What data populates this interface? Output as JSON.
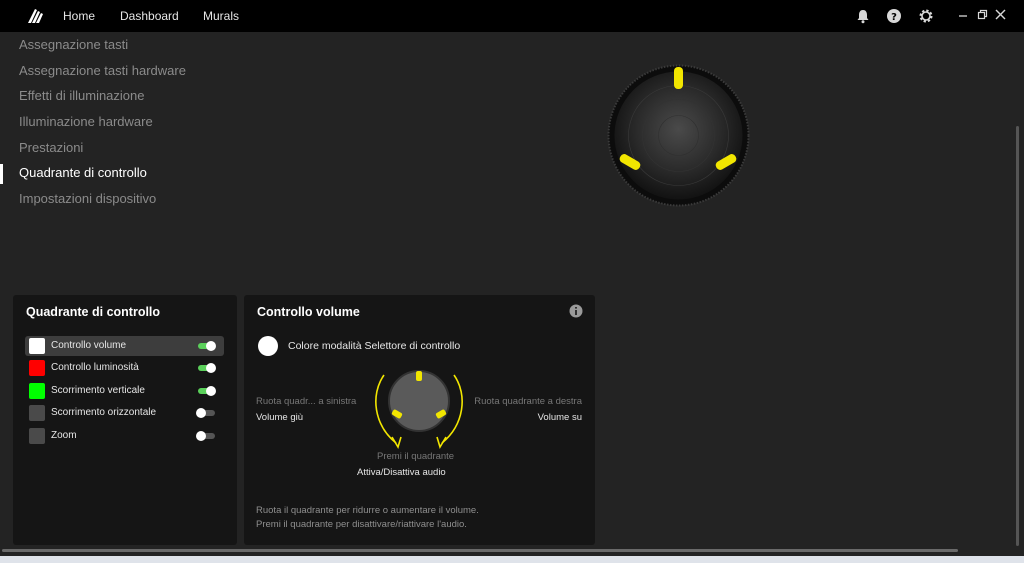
{
  "topbar": {
    "nav": [
      "Home",
      "Dashboard",
      "Murals"
    ],
    "icons": [
      "bell-icon",
      "help-icon",
      "gear-icon"
    ],
    "window_controls": [
      "minimize-icon",
      "restore-icon",
      "close-icon"
    ]
  },
  "sidebar": {
    "items": [
      {
        "label": "Assegnazione tasti"
      },
      {
        "label": "Assegnazione tasti hardware"
      },
      {
        "label": "Effetti di illuminazione"
      },
      {
        "label": "Illuminazione hardware"
      },
      {
        "label": "Prestazioni"
      },
      {
        "label": "Quadrante di controllo",
        "active": true
      },
      {
        "label": "Impostazioni dispositivo"
      }
    ]
  },
  "dial_panel": {
    "title": "Quadrante di controllo",
    "items": [
      {
        "label": "Controllo volume",
        "color": "#ffffff",
        "enabled": true,
        "selected": true
      },
      {
        "label": "Controllo luminosità",
        "color": "#ff0000",
        "enabled": true
      },
      {
        "label": "Scorrimento verticale",
        "color": "#00ff00",
        "enabled": true
      },
      {
        "label": "Scorrimento orizzontale",
        "color": "#4a4a4a",
        "enabled": false
      },
      {
        "label": "Zoom",
        "color": "#4a4a4a",
        "enabled": false
      }
    ]
  },
  "volume_panel": {
    "title": "Controllo volume",
    "color_mode_label": "Colore modalità Selettore di controllo",
    "color_mode_color": "#ffffff",
    "left_action_hint": "Ruota quadr... a sinistra",
    "left_action": "Volume giù",
    "right_action_hint": "Ruota quadrante a destra",
    "right_action": "Volume su",
    "press_hint": "Premi il quadrante",
    "press_action": "Attiva/Disattiva audio",
    "help_line1": "Ruota il quadrante per ridurre o aumentare il volume.",
    "help_line2": "Premi il quadrante per disattivare/riattivare l'audio."
  },
  "colors": {
    "accent_yellow": "#f2e600",
    "toggle_on": "#5ad05a",
    "toggle_off": "#555555"
  }
}
